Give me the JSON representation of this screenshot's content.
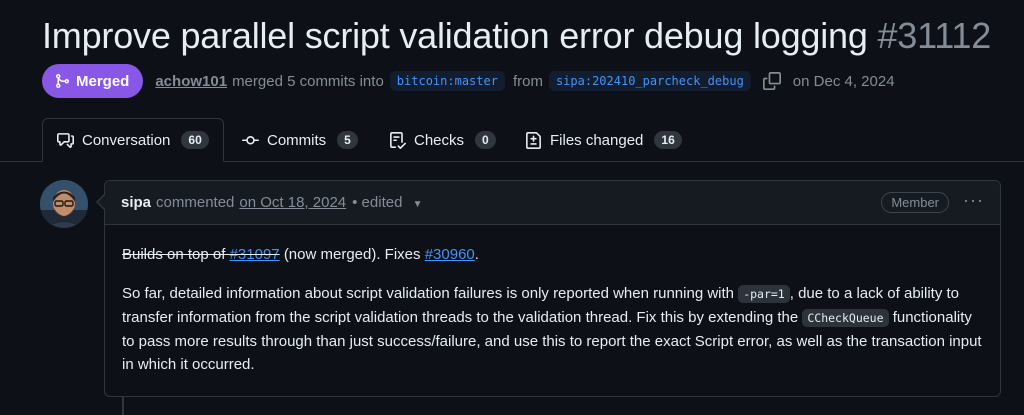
{
  "pr": {
    "title": "Improve parallel script validation error debug logging",
    "number": "#31112",
    "status_label": "Merged",
    "author": "achow101",
    "merged_text": "merged 5 commits into",
    "base_branch": "bitcoin:master",
    "from_text": "from",
    "head_branch": "sipa:202410_parcheck_debug",
    "date_text": "on Dec 4, 2024"
  },
  "tabs": [
    {
      "label": "Conversation",
      "count": "60",
      "icon": "conversation-icon"
    },
    {
      "label": "Commits",
      "count": "5",
      "icon": "commit-icon"
    },
    {
      "label": "Checks",
      "count": "0",
      "icon": "checks-icon"
    },
    {
      "label": "Files changed",
      "count": "16",
      "icon": "file-diff-icon"
    }
  ],
  "comment": {
    "author": "sipa",
    "action": "commented",
    "date": "on Oct 18, 2024",
    "edited": "• edited",
    "role_badge": "Member",
    "p1_strike": "Builds on top of",
    "p1_link1": "#31097",
    "p1_mid": "(now merged). Fixes",
    "p1_link2": "#30960",
    "p1_end": ".",
    "p2_a": "So far, detailed information about script validation failures is only reported when running with",
    "p2_code1": "-par=1",
    "p2_b": ", due to a lack of ability to transfer information from the script validation threads to the validation thread. Fix this by extending the",
    "p2_code2": "CCheckQueue",
    "p2_c": "functionality to pass more results through than just success/failure, and use this to report the exact Script error, as well as the transaction input in which it occurred."
  },
  "colors": {
    "background": "#0d1117",
    "merged": "#8957e5",
    "link": "#4493f8",
    "muted": "#848d97",
    "border": "#30363d"
  }
}
